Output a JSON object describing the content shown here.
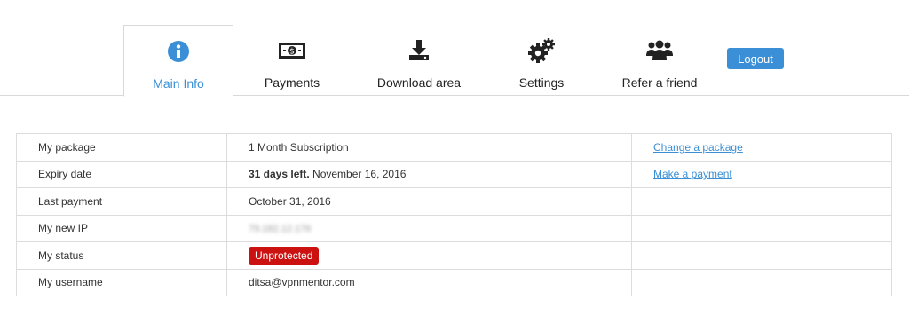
{
  "nav": {
    "tabs": [
      {
        "label": "Main Info",
        "icon": "info-icon",
        "active": true
      },
      {
        "label": "Payments",
        "icon": "banknote-icon",
        "active": false
      },
      {
        "label": "Download area",
        "icon": "download-icon",
        "active": false
      },
      {
        "label": "Settings",
        "icon": "gears-icon",
        "active": false
      },
      {
        "label": "Refer a friend",
        "icon": "users-icon",
        "active": false
      }
    ],
    "logout_label": "Logout"
  },
  "colors": {
    "accent": "#3a8fd6",
    "danger": "#cc1111",
    "border": "#dcdcdc"
  },
  "account": {
    "rows": [
      {
        "label": "My package",
        "value": "1 Month Subscription",
        "action": "Change a package"
      },
      {
        "label": "Expiry date",
        "value_bold": "31 days left.",
        "value": " November 16, 2016",
        "action": "Make a payment"
      },
      {
        "label": "Last payment",
        "value": "October 31, 2016"
      },
      {
        "label": "My new IP",
        "value": "79.182.12.176"
      },
      {
        "label": "My status",
        "value": "Unprotected"
      },
      {
        "label": "My username",
        "value": "ditsa@vpnmentor.com"
      }
    ]
  }
}
